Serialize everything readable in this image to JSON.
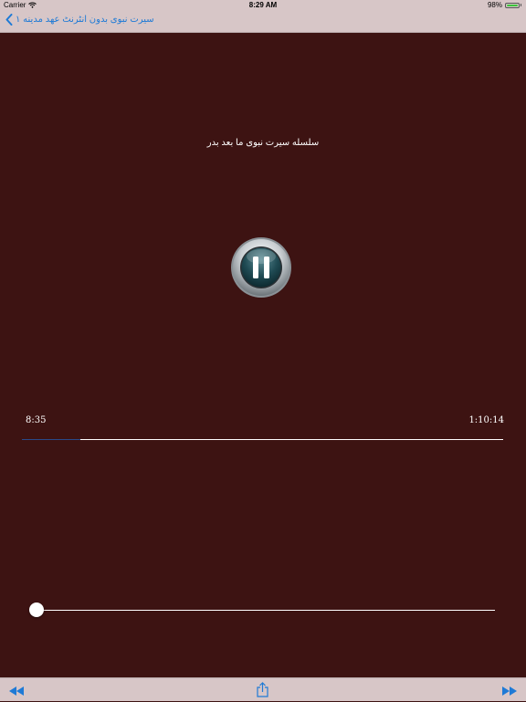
{
  "status_bar": {
    "carrier": "Carrier",
    "time": "8:29 AM",
    "battery": "98%",
    "battery_level": 0.98
  },
  "nav": {
    "title": "سیرت نبوی بدون انٹرنٹ عهد مدینه ۱"
  },
  "player": {
    "track_title": "سلسله سیرت نبوی ما بعد بدر",
    "elapsed": "8:35",
    "total": "1:10:14",
    "state": "playing",
    "progress_fraction": 0.122,
    "volume_fraction": 0.0
  },
  "toolbar": {
    "icons": [
      "rewind-icon",
      "share-icon",
      "fast-forward-icon"
    ]
  },
  "colors": {
    "accent": "#1e7ad6",
    "bars": "#d7c6c7",
    "background": "#3d1312",
    "progress_played": "#2a4a8a"
  }
}
